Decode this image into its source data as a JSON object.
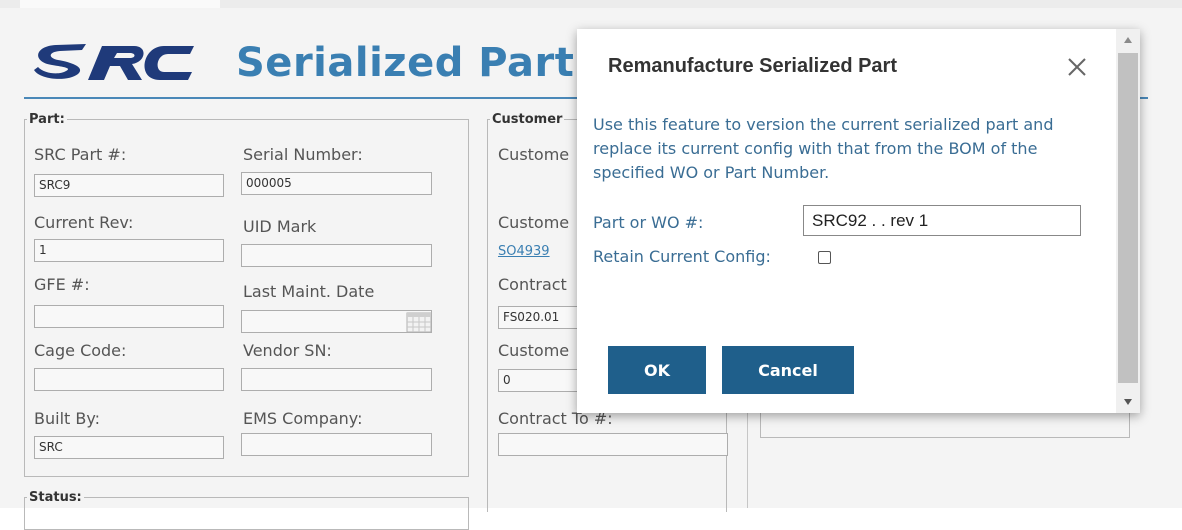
{
  "page": {
    "title": "Serialized Part"
  },
  "colors": {
    "brand_blue": "#3a7fb2",
    "logo_navy": "#1f3a7a",
    "button_blue": "#1f5f8b"
  },
  "part_section": {
    "legend": "Part:",
    "src_part_label": "SRC Part #:",
    "src_part_value": "SRC9",
    "serial_label": "Serial Number:",
    "serial_value": "000005",
    "current_rev_label": "Current Rev:",
    "current_rev_value": "1",
    "uid_label": "UID Mark",
    "uid_value": "",
    "gfe_label": "GFE #:",
    "gfe_value": "",
    "last_maint_label": "Last Maint. Date",
    "last_maint_value": "",
    "cage_label": "Cage Code:",
    "cage_value": "",
    "vendor_sn_label": "Vendor SN:",
    "vendor_sn_value": "",
    "built_by_label": "Built By:",
    "built_by_value": "SRC",
    "ems_label": "EMS Company:",
    "ems_value": ""
  },
  "status_section": {
    "legend": "Status:"
  },
  "customer_section": {
    "legend": "Customer",
    "customer_label_1": "Custome",
    "customer_label_2": "Custome",
    "so_link": "SO4939",
    "contract_label": "Contract",
    "contract_value": "FS020.01",
    "customer_label_3": "Custome",
    "customer_value_3": "0",
    "contract_to_label": "Contract To #:",
    "contract_to_value": ""
  },
  "modal": {
    "title": "Remanufacture Serialized Part",
    "description": "Use this feature to version the current serialized part and replace its current config with that from the BOM of the specified WO or Part Number.",
    "part_wo_label": "Part or WO #:",
    "part_wo_value": "SRC92 . . rev 1",
    "retain_label": "Retain Current Config:",
    "retain_checked": false,
    "ok_label": "OK",
    "cancel_label": "Cancel",
    "close_icon": "close-icon"
  }
}
